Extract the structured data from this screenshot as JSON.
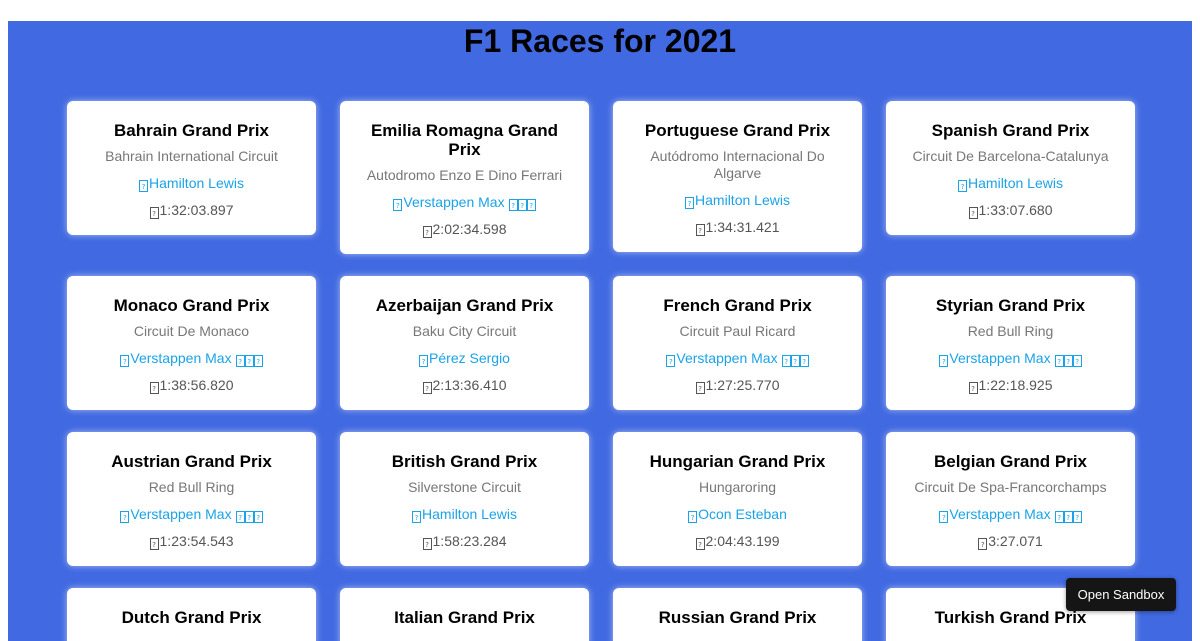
{
  "title": "F1 Races for 2021",
  "races": [
    {
      "name": "Bahrain Grand Prix",
      "circuit": "Bahrain International Circuit",
      "winner": "Hamilton Lewis",
      "flag": false,
      "time": "1:32:03.897"
    },
    {
      "name": "Emilia Romagna Grand Prix",
      "circuit": "Autodromo Enzo E Dino Ferrari",
      "winner": "Verstappen Max",
      "flag": true,
      "time": "2:02:34.598"
    },
    {
      "name": "Portuguese Grand Prix",
      "circuit": "Autódromo Internacional Do Algarve",
      "winner": "Hamilton Lewis",
      "flag": false,
      "time": "1:34:31.421"
    },
    {
      "name": "Spanish Grand Prix",
      "circuit": "Circuit De Barcelona-Catalunya",
      "winner": "Hamilton Lewis",
      "flag": false,
      "time": "1:33:07.680"
    },
    {
      "name": "Monaco Grand Prix",
      "circuit": "Circuit De Monaco",
      "winner": "Verstappen Max",
      "flag": true,
      "time": "1:38:56.820"
    },
    {
      "name": "Azerbaijan Grand Prix",
      "circuit": "Baku City Circuit",
      "winner": "Pérez Sergio",
      "flag": false,
      "time": "2:13:36.410"
    },
    {
      "name": "French Grand Prix",
      "circuit": "Circuit Paul Ricard",
      "winner": "Verstappen Max",
      "flag": true,
      "time": "1:27:25.770"
    },
    {
      "name": "Styrian Grand Prix",
      "circuit": "Red Bull Ring",
      "winner": "Verstappen Max",
      "flag": true,
      "time": "1:22:18.925"
    },
    {
      "name": "Austrian Grand Prix",
      "circuit": "Red Bull Ring",
      "winner": "Verstappen Max",
      "flag": true,
      "time": "1:23:54.543"
    },
    {
      "name": "British Grand Prix",
      "circuit": "Silverstone Circuit",
      "winner": "Hamilton Lewis",
      "flag": false,
      "time": "1:58:23.284"
    },
    {
      "name": "Hungarian Grand Prix",
      "circuit": "Hungaroring",
      "winner": "Ocon Esteban",
      "flag": false,
      "time": "2:04:43.199"
    },
    {
      "name": "Belgian Grand Prix",
      "circuit": "Circuit De Spa-Francorchamps",
      "winner": "Verstappen Max",
      "flag": true,
      "time": "3:27.071"
    },
    {
      "name": "Dutch Grand Prix",
      "circuit": "",
      "winner": "",
      "flag": false,
      "time": ""
    },
    {
      "name": "Italian Grand Prix",
      "circuit": "",
      "winner": "",
      "flag": false,
      "time": ""
    },
    {
      "name": "Russian Grand Prix",
      "circuit": "",
      "winner": "",
      "flag": false,
      "time": ""
    },
    {
      "name": "Turkish Grand Prix",
      "circuit": "",
      "winner": "",
      "flag": false,
      "time": ""
    }
  ],
  "sandbox_button": "Open Sandbox",
  "colors": {
    "background": "#4169e1",
    "card": "#ffffff",
    "winner_link": "#1aa3e8",
    "circuit_text": "#777777"
  }
}
